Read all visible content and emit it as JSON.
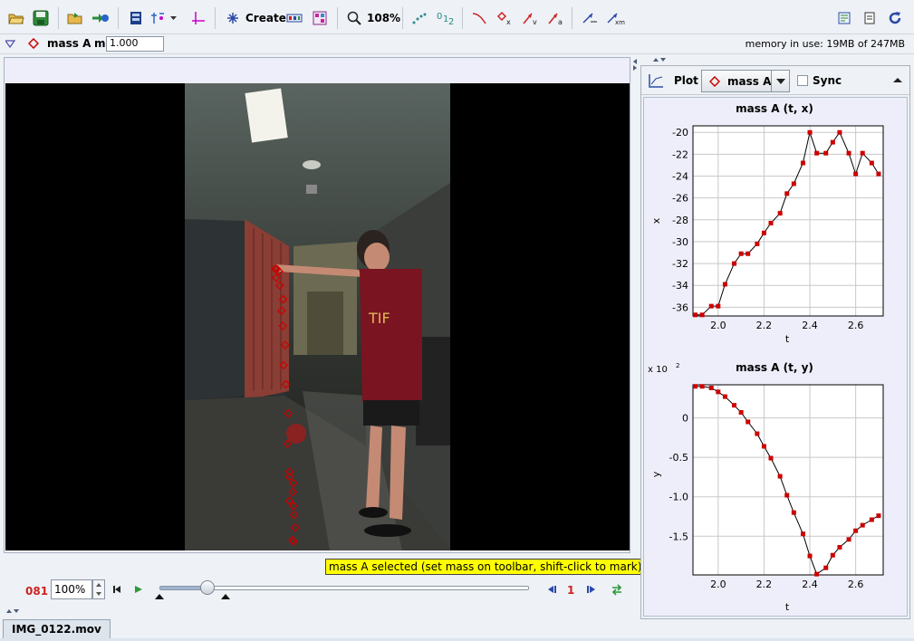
{
  "toolbar": {
    "create_label": "Create",
    "zoom_label": "108%",
    "memory_text": "memory in use: 19MB of 247MB"
  },
  "track": {
    "name": "mass A",
    "mass_label": "m",
    "mass_value": "1.000"
  },
  "video": {
    "status_message": "mass A selected (set mass on toolbar, shift-click to mark)",
    "frame_number": "081",
    "zoom_value": "100%",
    "step_number": "1",
    "slider_position": 0.13,
    "start_marker": 0.0,
    "end_marker": 0.18
  },
  "tab": {
    "file_name": "IMG_0122.mov"
  },
  "plot_panel": {
    "plot_label": "Plot",
    "selected_track": "mass A",
    "sync_label": "Sync",
    "sync_checked": false
  },
  "colors": {
    "track": "#cc0000",
    "accent": "#2a64c8"
  },
  "chart_data": [
    {
      "type": "line",
      "title": "mass A (t, x)",
      "xlabel": "t",
      "ylabel": "x",
      "xlim": [
        1.89,
        2.72
      ],
      "ylim": [
        -36.8,
        -19.4
      ],
      "xticks": [
        2.0,
        2.2,
        2.4,
        2.6
      ],
      "yticks": [
        -20,
        -22,
        -24,
        -26,
        -28,
        -30,
        -32,
        -34,
        -36
      ],
      "xticklabels": [
        "2.0",
        "2.2",
        "2.4",
        "2.6"
      ],
      "yticklabels": [
        "-20",
        "-22",
        "-24",
        "-26",
        "-28",
        "-30",
        "-32",
        "-34",
        "-36"
      ],
      "grid": true,
      "x": [
        1.9,
        1.93,
        1.97,
        2.0,
        2.03,
        2.07,
        2.1,
        2.13,
        2.17,
        2.2,
        2.23,
        2.27,
        2.3,
        2.33,
        2.37,
        2.4,
        2.43,
        2.47,
        2.5,
        2.53,
        2.57,
        2.6,
        2.63,
        2.67,
        2.7
      ],
      "y": [
        -36.7,
        -36.7,
        -35.9,
        -35.9,
        -33.9,
        -32.0,
        -31.1,
        -31.1,
        -30.2,
        -29.2,
        -28.3,
        -27.4,
        -25.6,
        -24.7,
        -22.8,
        -20.0,
        -21.9,
        -21.9,
        -20.9,
        -20.0,
        -21.9,
        -23.8,
        -21.9,
        -22.8,
        -23.8
      ]
    },
    {
      "type": "line",
      "title": "mass A (t, y)",
      "xlabel": "t",
      "ylabel": "y",
      "scale_label": "x 10",
      "scale_exponent": "2",
      "xlim": [
        1.89,
        2.72
      ],
      "ylim": [
        -1.99,
        0.42
      ],
      "xticks": [
        2.0,
        2.2,
        2.4,
        2.6
      ],
      "yticks": [
        0,
        -0.5,
        -1.0,
        -1.5
      ],
      "xticklabels": [
        "2.0",
        "2.2",
        "2.4",
        "2.6"
      ],
      "yticklabels": [
        "0",
        "-0.5",
        "-1.0",
        "-1.5"
      ],
      "grid": true,
      "x": [
        1.9,
        1.93,
        1.97,
        2.0,
        2.03,
        2.07,
        2.1,
        2.13,
        2.17,
        2.2,
        2.23,
        2.27,
        2.3,
        2.33,
        2.37,
        2.4,
        2.43,
        2.47,
        2.5,
        2.53,
        2.57,
        2.6,
        2.63,
        2.67,
        2.7
      ],
      "y": [
        0.4,
        0.4,
        0.38,
        0.33,
        0.27,
        0.16,
        0.07,
        -0.05,
        -0.2,
        -0.36,
        -0.51,
        -0.74,
        -0.98,
        -1.2,
        -1.47,
        -1.75,
        -1.98,
        -1.9,
        -1.74,
        -1.64,
        -1.54,
        -1.43,
        -1.36,
        -1.29,
        -1.24
      ]
    }
  ]
}
